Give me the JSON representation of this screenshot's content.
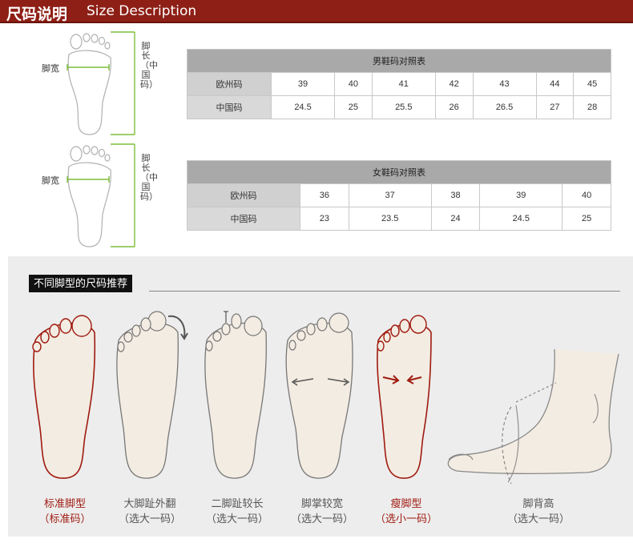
{
  "header": {
    "title_cn": "尺码说明",
    "title_en": "Size Description"
  },
  "diagrams": {
    "width_label": "脚宽",
    "length_label": "脚长（中国码）"
  },
  "men_table": {
    "title": "男鞋码对照表",
    "eu_label": "欧州码",
    "cn_label": "中国码",
    "eu": [
      "39",
      "40",
      "41",
      "42",
      "43",
      "44",
      "45"
    ],
    "cn": [
      "24.5",
      "25",
      "25.5",
      "26",
      "26.5",
      "27",
      "28"
    ]
  },
  "women_table": {
    "title": "女鞋码对照表",
    "eu_label": "欧州码",
    "cn_label": "中国码",
    "eu": [
      "36",
      "37",
      "38",
      "39",
      "40"
    ],
    "cn": [
      "23",
      "23.5",
      "24",
      "24.5",
      "25"
    ]
  },
  "recommend": {
    "title": "不同脚型的尺码推荐",
    "types": [
      {
        "name": "标准脚型",
        "advice": "（标准码）",
        "color": "#9f1a10"
      },
      {
        "name": "大脚趾外翻",
        "advice": "（选大一码）",
        "color": "#555555"
      },
      {
        "name": "二脚趾较长",
        "advice": "（选大一码）",
        "color": "#555555"
      },
      {
        "name": "脚掌较宽",
        "advice": "（选大一码）",
        "color": "#555555"
      },
      {
        "name": "瘦脚型",
        "advice": "（选小一码）",
        "color": "#9f1a10"
      },
      {
        "name": "脚背高",
        "advice": "（选大一码）",
        "color": "#555555"
      }
    ]
  },
  "colors": {
    "brand": "#8e1f16",
    "accent_green": "#7cbf3a",
    "skin": "#f3ece2"
  }
}
